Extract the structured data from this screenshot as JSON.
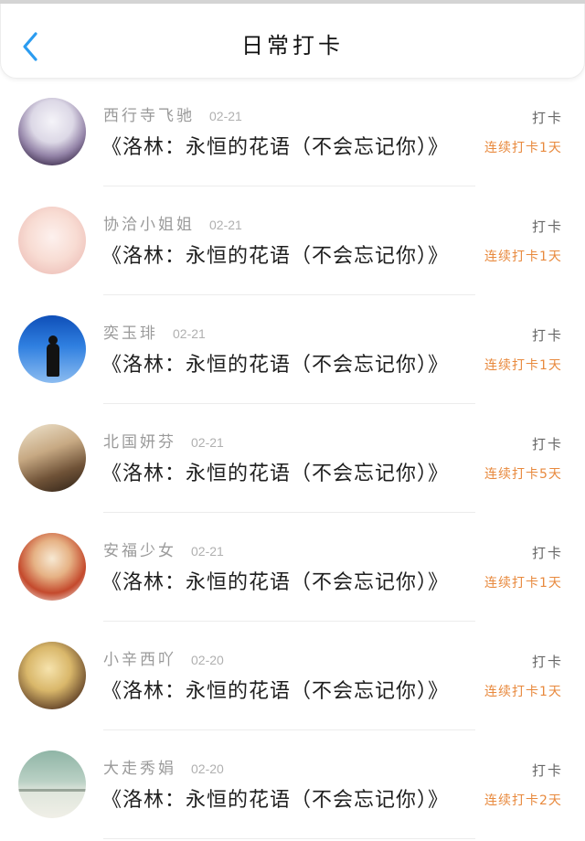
{
  "header": {
    "back_icon": "chevron-left-icon",
    "title": "日常打卡"
  },
  "colors": {
    "accent": "#2b9cf0",
    "streak": "#e8893d",
    "name": "#9a9a9a",
    "date": "#b0b0b0",
    "content": "#1f1f1f",
    "tag": "#666666"
  },
  "checkins": [
    {
      "name": "西行寺飞驰",
      "date": "02-21",
      "tag": "打卡",
      "content": "《洛林：永恒的花语（不会忘记你）》",
      "streak": "连续打卡1天"
    },
    {
      "name": "协洽小姐姐",
      "date": "02-21",
      "tag": "打卡",
      "content": "《洛林：永恒的花语（不会忘记你）》",
      "streak": "连续打卡1天"
    },
    {
      "name": "奕玉琲",
      "date": "02-21",
      "tag": "打卡",
      "content": "《洛林：永恒的花语（不会忘记你）》",
      "streak": "连续打卡1天"
    },
    {
      "name": "北国妍芬",
      "date": "02-21",
      "tag": "打卡",
      "content": "《洛林：永恒的花语（不会忘记你）》",
      "streak": "连续打卡5天"
    },
    {
      "name": "安福少女",
      "date": "02-21",
      "tag": "打卡",
      "content": "《洛林：永恒的花语（不会忘记你）》",
      "streak": "连续打卡1天"
    },
    {
      "name": "小辛西吖",
      "date": "02-20",
      "tag": "打卡",
      "content": "《洛林：永恒的花语（不会忘记你）》",
      "streak": "连续打卡1天"
    },
    {
      "name": "大走秀娟",
      "date": "02-20",
      "tag": "打卡",
      "content": "《洛林：永恒的花语（不会忘记你）》",
      "streak": "连续打卡2天"
    }
  ]
}
